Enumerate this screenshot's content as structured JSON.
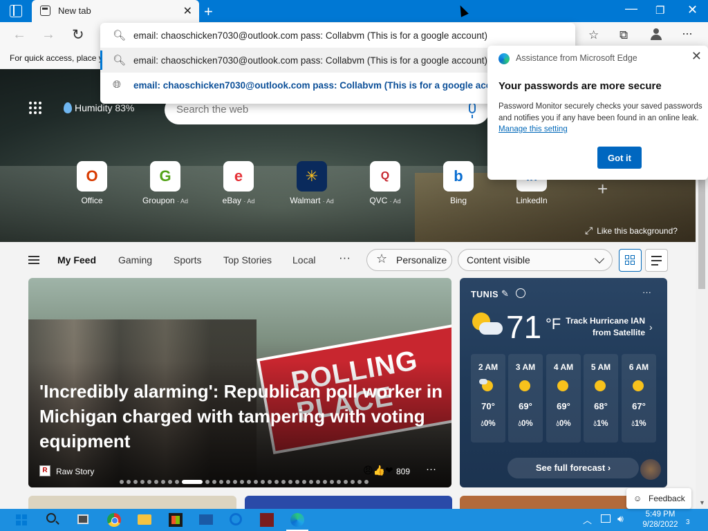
{
  "window": {
    "tab_title": "New tab"
  },
  "omnibox": {
    "typed_text": "email: chaoschicken7030@outlook.com pass: Collabvm (This is for a google account)",
    "suggestions": [
      {
        "text": "email: chaoschicken7030@outlook.com pass: Collabvm (This is for a google account)"
      },
      {
        "text": "email: chaoschicken7030@outlook.com pass: Collabvm (This is for a google account)"
      }
    ]
  },
  "favorites_bar": {
    "text": "For quick access, place y"
  },
  "hero": {
    "humidity": "Humidity 83%",
    "search_placeholder": "Search the web",
    "like_background": "Like this background?",
    "quick_links": [
      {
        "name": "Office",
        "ad": "",
        "glyph": "O",
        "color": "#d83b01"
      },
      {
        "name": "Groupon",
        "ad": "· Ad",
        "glyph": "G",
        "color": "#53a318"
      },
      {
        "name": "eBay",
        "ad": "· Ad",
        "glyph": "e",
        "color": "#e53238"
      },
      {
        "name": "Walmart",
        "ad": "· Ad",
        "glyph": "✳",
        "color": "#ffc220"
      },
      {
        "name": "QVC",
        "ad": "· Ad",
        "glyph": "Q",
        "color": "#c6262e"
      },
      {
        "name": "Bing",
        "ad": "",
        "glyph": "b",
        "color": "#0a6ed1"
      },
      {
        "name": "LinkedIn",
        "ad": "",
        "glyph": "in",
        "color": "#0a66c2"
      }
    ]
  },
  "password_popup": {
    "header": "Assistance from Microsoft Edge",
    "title": "Your passwords are more secure",
    "body": "Password Monitor securely checks your saved passwords and notifies you if any have been found in an online leak.",
    "link": "Manage this setting",
    "button": "Got it"
  },
  "feed_nav": {
    "tabs": [
      "My Feed",
      "Gaming",
      "Sports",
      "Top Stories",
      "Local",
      "···"
    ],
    "personalize": "Personalize",
    "content_visible": "Content visible"
  },
  "hero_article": {
    "headline": "'Incredibly alarming': Republican poll worker in Michigan charged with tampering with voting equipment",
    "source": "Raw Story",
    "reactions": "809",
    "sign_text": "POLLING PLACE"
  },
  "weather": {
    "city": "TUNIS",
    "temp": "71",
    "unit": "°F",
    "track_text": "Track Hurricane IAN from Satellite",
    "hourly": [
      {
        "time": "2 AM",
        "temp": "70°",
        "precip": "0%"
      },
      {
        "time": "3 AM",
        "temp": "69°",
        "precip": "0%"
      },
      {
        "time": "4 AM",
        "temp": "69°",
        "precip": "0%"
      },
      {
        "time": "5 AM",
        "temp": "68°",
        "precip": "1%"
      },
      {
        "time": "6 AM",
        "temp": "67°",
        "precip": "1%"
      }
    ],
    "forecast_button": "See full forecast ›"
  },
  "feedback": {
    "label": "Feedback"
  },
  "taskbar": {
    "time": "5:49 PM",
    "date": "9/28/2022",
    "notifications": "3"
  }
}
